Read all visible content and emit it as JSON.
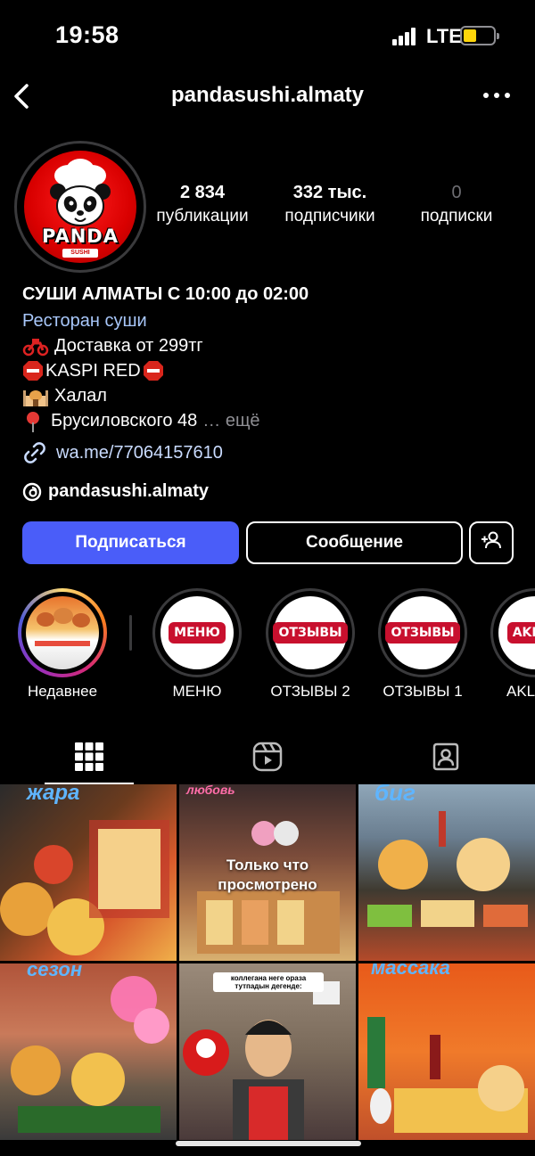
{
  "status_bar": {
    "time": "19:58",
    "network": "LTE",
    "battery_color": "#ffd60a"
  },
  "header": {
    "username": "pandasushi.almaty",
    "back_icon": "chevron-left-icon",
    "more_icon": "more-horizontal-icon"
  },
  "profile": {
    "avatar_text": "PANDA",
    "avatar_subtext": "SUSHI",
    "stats": [
      {
        "value": "2 834",
        "label": "публикации"
      },
      {
        "value": "332 тыс.",
        "label": "подписчики"
      },
      {
        "value": "0",
        "label": "подписки"
      }
    ],
    "bio_title": "СУШИ АЛМАТЫ С 10:00 до 02:00",
    "category": "Ресторан суши",
    "bio_lines": [
      {
        "icon": "motorbike-icon",
        "text": "Доставка от 299тг"
      },
      {
        "icon": "stop-sign-icon",
        "text": "KASPI RED"
      },
      {
        "icon": "mosque-icon",
        "text": "Халал"
      },
      {
        "icon": "pin-icon",
        "text": "Брусиловского 48"
      }
    ],
    "bio_more": "… ещё",
    "link": "wa.me/77064157610",
    "threads": "pandasushi.almaty"
  },
  "actions": {
    "follow": "Подписаться",
    "message": "Сообщение"
  },
  "accent_color": "#4a5df9",
  "highlights": [
    {
      "label": "Недавнее",
      "badge": ""
    },
    {
      "label": "МЕНЮ",
      "badge": "МЕНЮ"
    },
    {
      "label": "ОТЗЫВЫ 2",
      "badge": "ОТЗЫВЫ"
    },
    {
      "label": "ОТЗЫВЫ 1",
      "badge": "ОТЗЫВЫ"
    },
    {
      "label": "AKL",
      "badge": "AKL"
    }
  ],
  "tabs": [
    "grid-icon",
    "reels-icon",
    "tagged-icon"
  ],
  "grid": {
    "posts": [
      {
        "overlay": "жара"
      },
      {
        "overlay": "любовь",
        "viewed": "Только что просмотрено"
      },
      {
        "overlay": "биг"
      },
      {
        "overlay": "сезон"
      },
      {
        "overlay": "коллегана неге ораза тутпадын дегенде:"
      },
      {
        "overlay": "массака"
      }
    ]
  }
}
